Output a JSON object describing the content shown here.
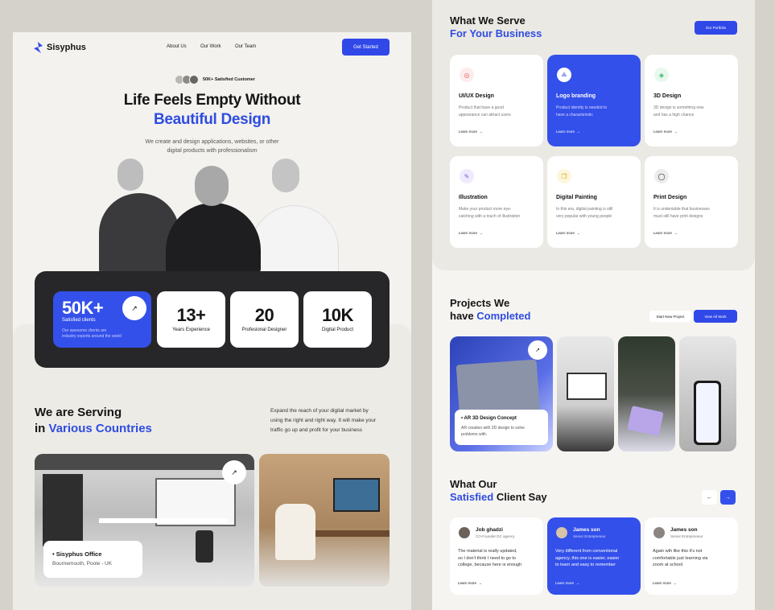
{
  "left": {
    "brand": "Sisyphus",
    "nav": [
      "About Us",
      "Our Work",
      "Our Team"
    ],
    "cta": "Get Started",
    "satisfied": "50K+ Satisfied Customer",
    "hero_line1": "Life Feels Empty Without",
    "hero_line2": "Beautiful Design",
    "hero_sub1": "We create and design applications, websites, or other",
    "hero_sub2": "digital products with professionalism",
    "stat_main": {
      "value": "50K+",
      "label": "Satisfied clients",
      "desc1": "Our awesome clients are",
      "desc2": "industry experts around the world"
    },
    "stats": [
      {
        "value": "13+",
        "label": "Years Experience"
      },
      {
        "value": "20",
        "label": "Profesional Designer"
      },
      {
        "value": "10K",
        "label": "Digital Product"
      }
    ],
    "serving_line1": "We are Serving",
    "serving_in": "in",
    "serving_blue": "Various Countries",
    "serving_p1": "Expand the reach of your digital market by",
    "serving_p2": "using the right and right way. It will make your",
    "serving_p3": "traffic go up and profit for your business",
    "office_name": "Sisyphus Office",
    "office_loc": "Bournemouth, Poole - UK"
  },
  "right": {
    "serve_line1": "What We Serve",
    "serve_blue": "For Your Business",
    "portfolio": "Our Portfolio",
    "services": [
      {
        "title": "UI/UX Design",
        "d1": "Product that have a good",
        "d2": "appearance can attract users",
        "more": "Learn more"
      },
      {
        "title": "Logo branding",
        "d1": "Product identity is needed to",
        "d2": "have a characteristic",
        "more": "Learn more"
      },
      {
        "title": "3D Design",
        "d1": "3D design is something new",
        "d2": "and has a high chance",
        "more": "Learn more"
      },
      {
        "title": "Illustration",
        "d1": "Make your product more eye-",
        "d2": "catching with a touch of illustration",
        "more": "Learn more"
      },
      {
        "title": "Digital Painting",
        "d1": "In this era, digital painting is still",
        "d2": "very popular with young people",
        "more": "Learn more"
      },
      {
        "title": "Print Design",
        "d1": "It is undeniable that businesses",
        "d2": "must still have print designs",
        "more": "Learn more"
      }
    ],
    "projects_line1": "Projects We",
    "projects_have": "have",
    "projects_blue": "Completed",
    "start_project": "Start New Project",
    "view_all": "View All Work",
    "project_title": "AR 3D Design Concept",
    "project_d1": "AR creation with 3D design to solve",
    "project_d2": "problems with.",
    "client_line1": "What Our",
    "client_blue": "Satisfied",
    "client_rest": "Client Say",
    "testimonials": [
      {
        "name": "Job ghadzi",
        "role": "CO-Founder DC agency",
        "q1": "The material is really updated,",
        "q2": "so I don't think I need to go to",
        "q3": "college, because here is enough",
        "more": "Learn more"
      },
      {
        "name": "James son",
        "role": "Senior Entrepreneur",
        "q1": "Very different from conventional",
        "q2": "agency, this one is easier, easier",
        "q3": "to learn and easy to remember",
        "more": "Learn more"
      },
      {
        "name": "James son",
        "role": "Senior Entrepreneur",
        "q1": "Again wth like this it's not",
        "q2": "comfortable just learning via",
        "q3": "zoom at school",
        "more": "Learn more"
      }
    ]
  },
  "colors": {
    "accent": "#3450ea",
    "dark": "#27272a"
  }
}
